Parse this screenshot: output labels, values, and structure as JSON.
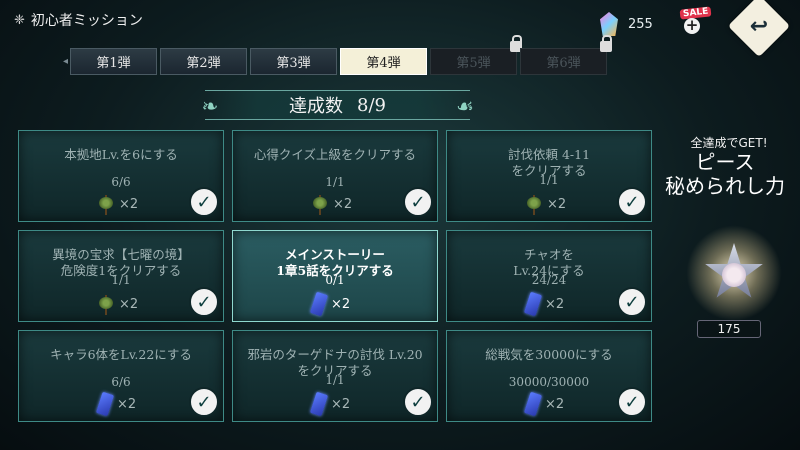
{
  "header": {
    "title": "初心者ミッション",
    "currency_value": "255",
    "sale_label": "SALE"
  },
  "tabs": [
    {
      "label": "第1弾",
      "state": "normal"
    },
    {
      "label": "第2弾",
      "state": "normal"
    },
    {
      "label": "第3弾",
      "state": "normal"
    },
    {
      "label": "第4弾",
      "state": "active"
    },
    {
      "label": "第5弾",
      "state": "locked"
    },
    {
      "label": "第6弾",
      "state": "locked"
    }
  ],
  "banner": {
    "label": "達成数",
    "value": "8/9"
  },
  "missions": [
    {
      "line1": "本拠地Lv.を6にする",
      "line2": "",
      "progress": "6/6",
      "reward_icon": "plant-item",
      "reward_qty": "×2",
      "completed": true
    },
    {
      "line1": "心得クイズ上級をクリアする",
      "line2": "",
      "progress": "1/1",
      "reward_icon": "plant-item",
      "reward_qty": "×2",
      "completed": true
    },
    {
      "line1": "討伐依頼 4-11",
      "line2": "をクリアする",
      "progress": "1/1",
      "reward_icon": "plant-item",
      "reward_qty": "×2",
      "completed": true
    },
    {
      "line1": "異境の宝求【七曜の境】",
      "line2": "危険度1をクリアする",
      "progress": "1/1",
      "reward_icon": "plant-item",
      "reward_qty": "×2",
      "completed": true
    },
    {
      "line1": "メインストーリー",
      "line2": "1章5話をクリアする",
      "progress": "0/1",
      "reward_icon": "ticket-item",
      "reward_qty": "×2",
      "completed": false
    },
    {
      "line1": "チャオを",
      "line2": "Lv.24にする",
      "progress": "24/24",
      "reward_icon": "ticket-item",
      "reward_qty": "×2",
      "completed": true
    },
    {
      "line1": "キャラ6体をLv.22にする",
      "line2": "",
      "progress": "6/6",
      "reward_icon": "ticket-item",
      "reward_qty": "×2",
      "completed": true
    },
    {
      "line1": "邪岩のターゲドナの討伐 Lv.20",
      "line2": "をクリアする",
      "progress": "1/1",
      "reward_icon": "ticket-item",
      "reward_qty": "×2",
      "completed": true
    },
    {
      "line1": "総戦気を30000にする",
      "line2": "",
      "progress": "30000/30000",
      "reward_icon": "ticket-item",
      "reward_qty": "×2",
      "completed": true
    }
  ],
  "complete_reward": {
    "caption": "全達成でGET!",
    "title_line1": "ピース",
    "title_line2": "秘められし力",
    "count": "175"
  }
}
